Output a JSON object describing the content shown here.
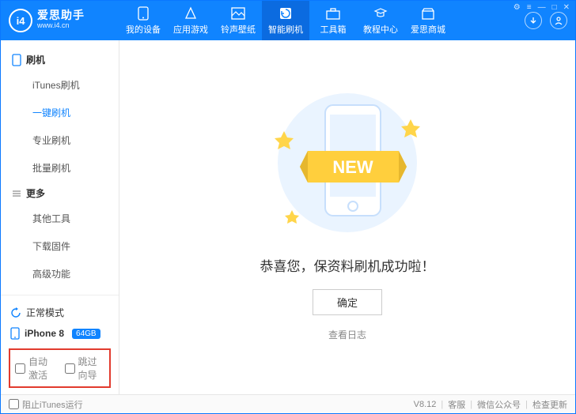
{
  "brand": {
    "logo_text": "i4",
    "name": "爱思助手",
    "url": "www.i4.cn"
  },
  "tabs": [
    {
      "label": "我的设备"
    },
    {
      "label": "应用游戏"
    },
    {
      "label": "铃声壁纸"
    },
    {
      "label": "智能刷机"
    },
    {
      "label": "工具箱"
    },
    {
      "label": "教程中心"
    },
    {
      "label": "爱思商城"
    }
  ],
  "sidebar": {
    "group1": {
      "title": "刷机",
      "items": [
        "iTunes刷机",
        "一键刷机",
        "专业刷机",
        "批量刷机"
      ],
      "active_index": 1
    },
    "group2": {
      "title": "更多",
      "items": [
        "其他工具",
        "下载固件",
        "高级功能"
      ]
    },
    "mode": "正常模式",
    "device_name": "iPhone 8",
    "device_badge": "64GB",
    "options": {
      "auto_activate": "自动激活",
      "skip_guide": "跳过向导"
    }
  },
  "main": {
    "new_label": "NEW",
    "congrats": "恭喜您，保资料刷机成功啦！",
    "confirm": "确定",
    "view_log": "查看日志"
  },
  "footer": {
    "block_itunes": "阻止iTunes运行",
    "version": "V8.12",
    "links": [
      "客服",
      "微信公众号",
      "检查更新"
    ]
  }
}
